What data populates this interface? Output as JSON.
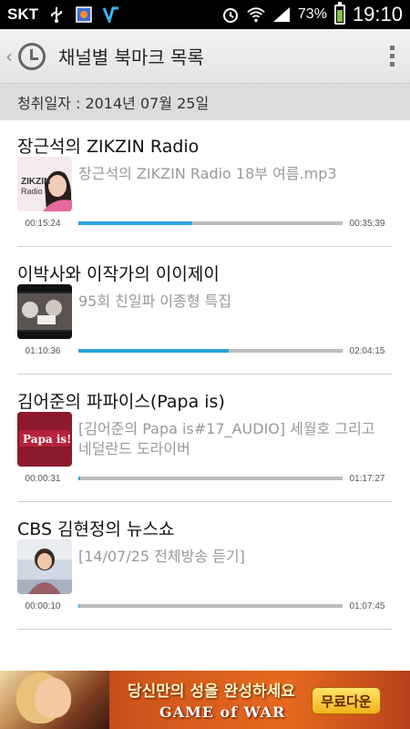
{
  "status_bar": {
    "carrier": "SKT",
    "battery_percent": "73%",
    "time": "19:10",
    "icons": [
      "usb-icon",
      "gallery-icon",
      "app-icon",
      "alarm-icon",
      "wifi-icon",
      "signal-icon",
      "battery-icon"
    ]
  },
  "action_bar": {
    "title": "채널별 북마크 목록",
    "logo_icon": "clock-icon",
    "menu_icon": "overflow-menu-icon"
  },
  "date_header": "청취일자 : 2014년 07월 25일",
  "bookmarks": [
    {
      "channel": "장근석의 ZIKZIN Radio",
      "episode": "장근석의 ZIKZIN Radio 18부 여름.mp3",
      "current_time": "00:15:24",
      "total_time": "00:35:39",
      "progress": 0.43
    },
    {
      "channel": "이박사와  이작가의 이이제이",
      "episode": "95회 친일파 이종형 특집",
      "current_time": "01:10:36",
      "total_time": "02:04:15",
      "progress": 0.57
    },
    {
      "channel": "김어준의 파파이스(Papa is)",
      "episode": "[김어준의 Papa is#17_AUDIO] 세월호 그리고 네덜란드 도라이버",
      "current_time": "00:00:31",
      "total_time": "01:17:27",
      "progress": 0.007
    },
    {
      "channel": "CBS 김현정의 뉴스쇼",
      "episode": "[14/07/25 전체방송 듣기]",
      "current_time": "00:00:10",
      "total_time": "01:07:45",
      "progress": 0.003
    }
  ],
  "thumb_texts": {
    "zikzin": "ZIKZIN\nRadio",
    "papa": "Papa is!"
  },
  "ad": {
    "headline": "당신만의 성을 완성하세요",
    "brand": "GAME of WAR",
    "cta": "무료다운"
  },
  "colors": {
    "progress": "#29a3dc",
    "track": "#bdbdbd"
  }
}
